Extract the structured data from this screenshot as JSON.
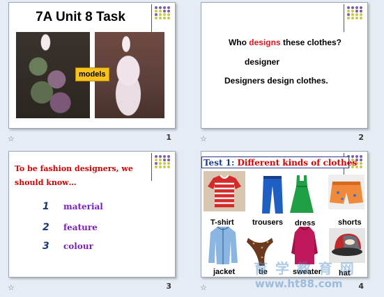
{
  "slides": [
    {
      "number": "1",
      "title": "7A  Unit 8 Task",
      "label": "models"
    },
    {
      "number": "2",
      "question_pre": "Who ",
      "question_red": "designs",
      "question_post": " these clothes?",
      "answer1": "designer",
      "answer2": "Designers design clothes."
    },
    {
      "number": "3",
      "question": "To be fashion designers, we should know…",
      "items": [
        {
          "bullet": "1",
          "text": "material"
        },
        {
          "bullet": "2",
          "text": "feature"
        },
        {
          "bullet": "3",
          "text": "colour"
        }
      ]
    },
    {
      "number": "4",
      "title_prefix": "Test 1:",
      "title": "Different kinds of clothes",
      "clothes": [
        "T-shirt",
        "trousers",
        "dress",
        "shorts",
        "jacket",
        "tie",
        "sweater",
        "hat"
      ]
    }
  ],
  "slide_marker": "☆",
  "deco_colors": [
    "#7b5ea7",
    "#7b5ea7",
    "#7b5ea7",
    "#7b5ea7",
    "#c8c84a",
    "#c8c84a",
    "#7b5ea7",
    "#7b5ea7",
    "#7b5ea7",
    "#c8c84a",
    "#c8c84a",
    "#c8c84a",
    "#c8c84a",
    "#c8c84a",
    "#c8c84a",
    "#c8c84a"
  ],
  "watermark": {
    "logo": "育 学 教 育 网",
    "url": "www.ht88.com"
  }
}
